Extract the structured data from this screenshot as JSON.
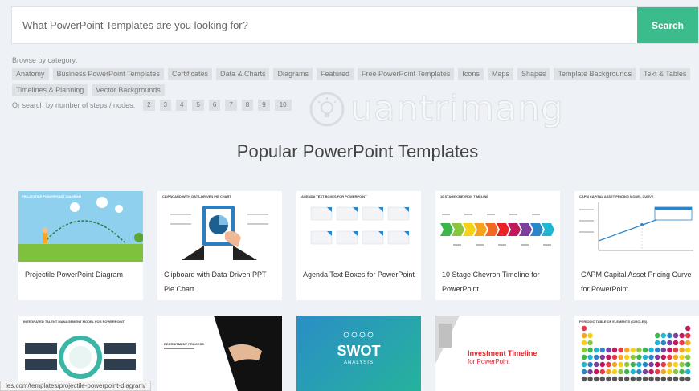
{
  "search": {
    "placeholder": "What PowerPoint Templates are you looking for?",
    "button_label": "Search"
  },
  "browse": {
    "label": "Browse by category:",
    "categories_row1": [
      "Anatomy",
      "Business PowerPoint Templates",
      "Certificates",
      "Data & Charts",
      "Diagrams",
      "Featured",
      "Free PowerPoint Templates",
      "Icons",
      "Maps",
      "Shapes",
      "Template Backgrounds",
      "Text & Tables"
    ],
    "categories_row2": [
      "Timelines & Planning",
      "Vector Backgrounds"
    ]
  },
  "steps": {
    "label": "Or search by number of steps / nodes:",
    "numbers": [
      "2",
      "3",
      "4",
      "5",
      "6",
      "7",
      "8",
      "9",
      "10"
    ]
  },
  "watermark": {
    "text": "uantrimang"
  },
  "section": {
    "title": "Popular PowerPoint Templates"
  },
  "templates": [
    {
      "title": "Projectile PowerPoint Diagram",
      "thumb_caption": "PROJECTILE POWERPOINT DIAGRAM"
    },
    {
      "title": "Clipboard with Data-Driven PPT Pie Chart",
      "thumb_caption": "CLIPBOARD WITH DATA-DRIVEN PIE CHART"
    },
    {
      "title": "Agenda Text Boxes for PowerPoint",
      "thumb_caption": "AGENDA TEXT BOXES FOR POWERPOINT"
    },
    {
      "title": "10 Stage Chevron Timeline for PowerPoint",
      "thumb_caption": "10 STAGE CHEVRON TIMELINE"
    },
    {
      "title": "CAPM Capital Asset Pricing Curve for PowerPoint",
      "thumb_caption": "CAPM CAPITAL ASSET PRICING MODEL CURVE"
    }
  ],
  "templates_row2": [
    {
      "thumb_caption": "INTEGRATED TALENT MANAGEMENT MODEL FOR POWERPOINT"
    },
    {
      "thumb_caption": "RECRUITMENT PROCESS"
    },
    {
      "thumb_caption": "SWOT",
      "thumb_sub": "ANALYSIS"
    },
    {
      "thumb_caption": "Investment Timeline",
      "thumb_sub": "for PowerPoint"
    },
    {
      "thumb_caption": "PERIODIC TABLE OF ELEMENTS (CIRCLES)"
    }
  ],
  "status_bar": {
    "url": "les.com/templates/projectile-powerpoint-diagram/"
  },
  "colors": {
    "accent": "#3cbc8d",
    "background": "#eef1f5"
  }
}
